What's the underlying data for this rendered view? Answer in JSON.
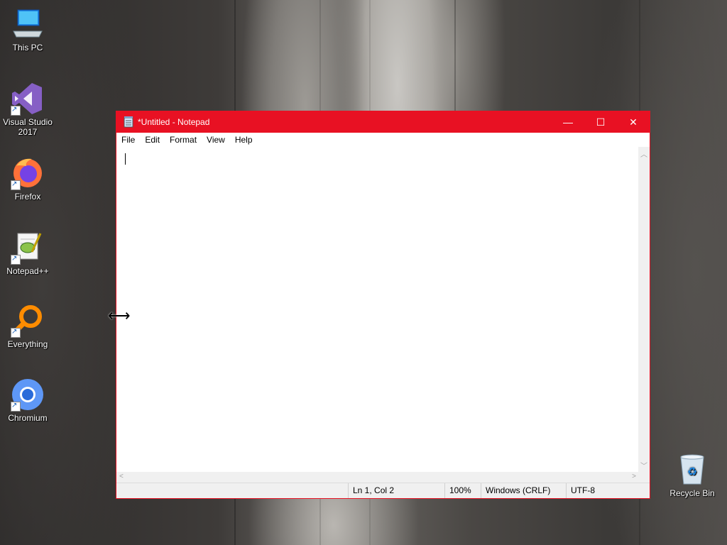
{
  "desktop": {
    "icons": [
      {
        "label": "This PC",
        "icon": "computer-icon"
      },
      {
        "label": "Visual Studio 2017",
        "icon": "visual-studio-icon"
      },
      {
        "label": "Firefox",
        "icon": "firefox-icon"
      },
      {
        "label": "Notepad++",
        "icon": "notepadpp-icon"
      },
      {
        "label": "Everything",
        "icon": "everything-search-icon"
      },
      {
        "label": "Chromium",
        "icon": "chromium-icon"
      },
      {
        "label": "Recycle Bin",
        "icon": "recycle-bin-icon"
      }
    ]
  },
  "window": {
    "title": "*Untitled - Notepad",
    "accent": "#e81123",
    "controls": {
      "minimize": "—",
      "maximize": "☐",
      "close": "✕"
    },
    "menu": [
      "File",
      "Edit",
      "Format",
      "View",
      "Help"
    ],
    "content": "",
    "status": {
      "position": "Ln 1, Col 2",
      "zoom": "100%",
      "line_ending": "Windows (CRLF)",
      "encoding": "UTF-8"
    }
  }
}
